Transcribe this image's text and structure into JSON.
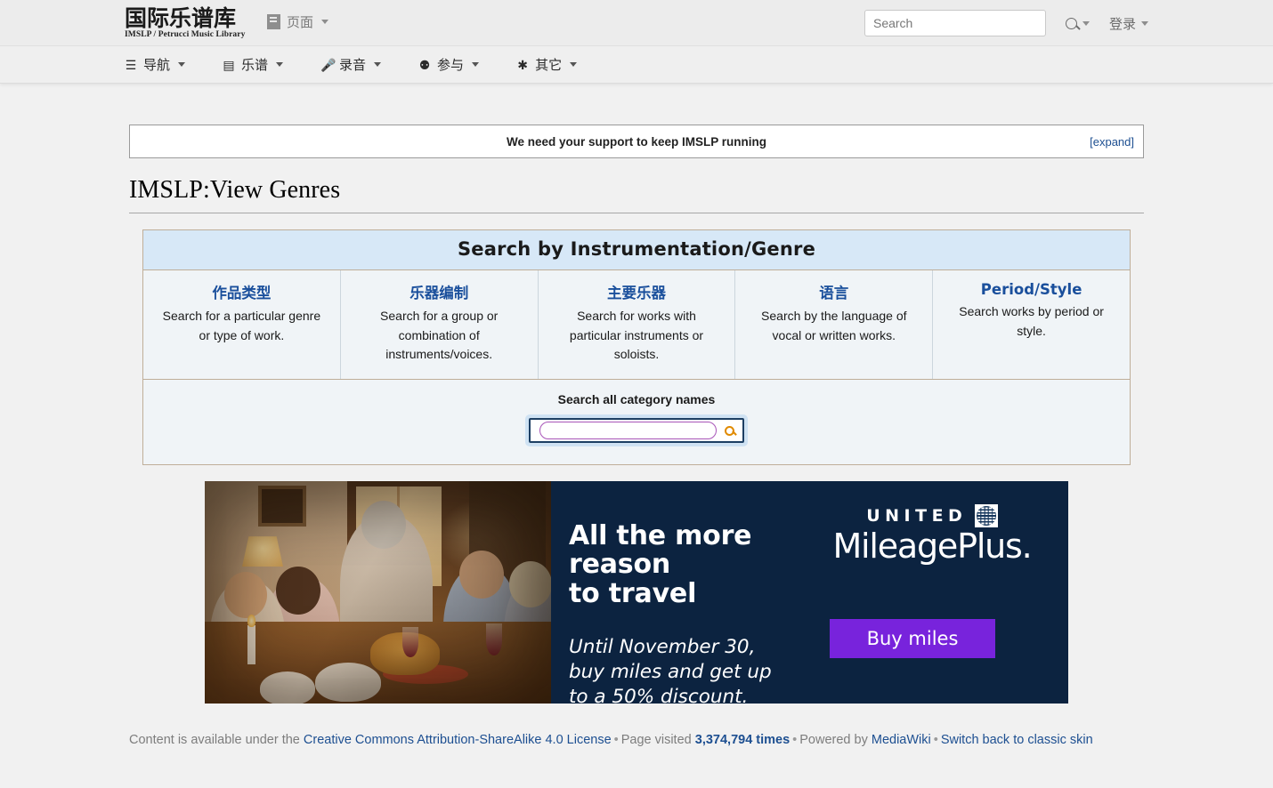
{
  "header": {
    "logo_cn": "国际乐谱库",
    "logo_en": "IMSLP / Petrucci Music Library",
    "page_menu_label": "页面",
    "page_menu_icon": "document-icon",
    "search_placeholder": "Search",
    "search_value": "",
    "search_tool_icon": "search-icon",
    "login_label": "登录"
  },
  "nav": {
    "items": [
      {
        "label": "导航",
        "icon": "hamburger-icon",
        "glyph": "☰"
      },
      {
        "label": "乐谱",
        "icon": "book-icon",
        "glyph": "▤"
      },
      {
        "label": "录音",
        "icon": "microphone-icon",
        "glyph": "🎤"
      },
      {
        "label": "参与",
        "icon": "person-icon",
        "glyph": "⚉"
      },
      {
        "label": "其它",
        "icon": "asterisk-icon",
        "glyph": "✱"
      }
    ]
  },
  "banner": {
    "message": "We need your support to keep IMSLP running",
    "expand_label": "[expand]"
  },
  "page": {
    "title": "IMSLP:View Genres"
  },
  "genre_table": {
    "heading": "Search by Instrumentation/Genre",
    "columns": [
      {
        "title": "作品类型",
        "desc": "Search for a particular genre or type of work."
      },
      {
        "title": "乐器编制",
        "desc": "Search for a group or combination of instruments/voices."
      },
      {
        "title": "主要乐器",
        "desc": "Search for works with particular instruments or soloists."
      },
      {
        "title": "语言",
        "desc": "Search by the language of vocal or written works."
      },
      {
        "title": "Period/Style",
        "desc": "Search works by period or style."
      }
    ],
    "category_search": {
      "label": "Search all category names",
      "input_value": "",
      "input_placeholder": "",
      "button_icon": "search-icon"
    }
  },
  "ad": {
    "headline": "All the more reason\nto travel",
    "subline": "Until November 30,\nbuy miles and get up\nto a 50% discount.",
    "brand_top": "UNITED",
    "brand_icon": "united-globe-icon",
    "brand_bottom": "MileagePlus.",
    "cta_label": "Buy miles",
    "cta_color": "#7823dc",
    "background_color": "#0c2340",
    "photo_alt": "family-thanksgiving-dinner-photo"
  },
  "footer": {
    "prefix": "Content is available under the",
    "license_link": "Creative Commons Attribution-ShareAlike 4.0 License",
    "visited_prefix": "Page visited",
    "visit_count": "3,374,794 times",
    "powered_prefix": "Powered by",
    "mediawiki_link": "MediaWiki",
    "classic_skin_link": "Switch back to classic skin",
    "separator": "•"
  }
}
